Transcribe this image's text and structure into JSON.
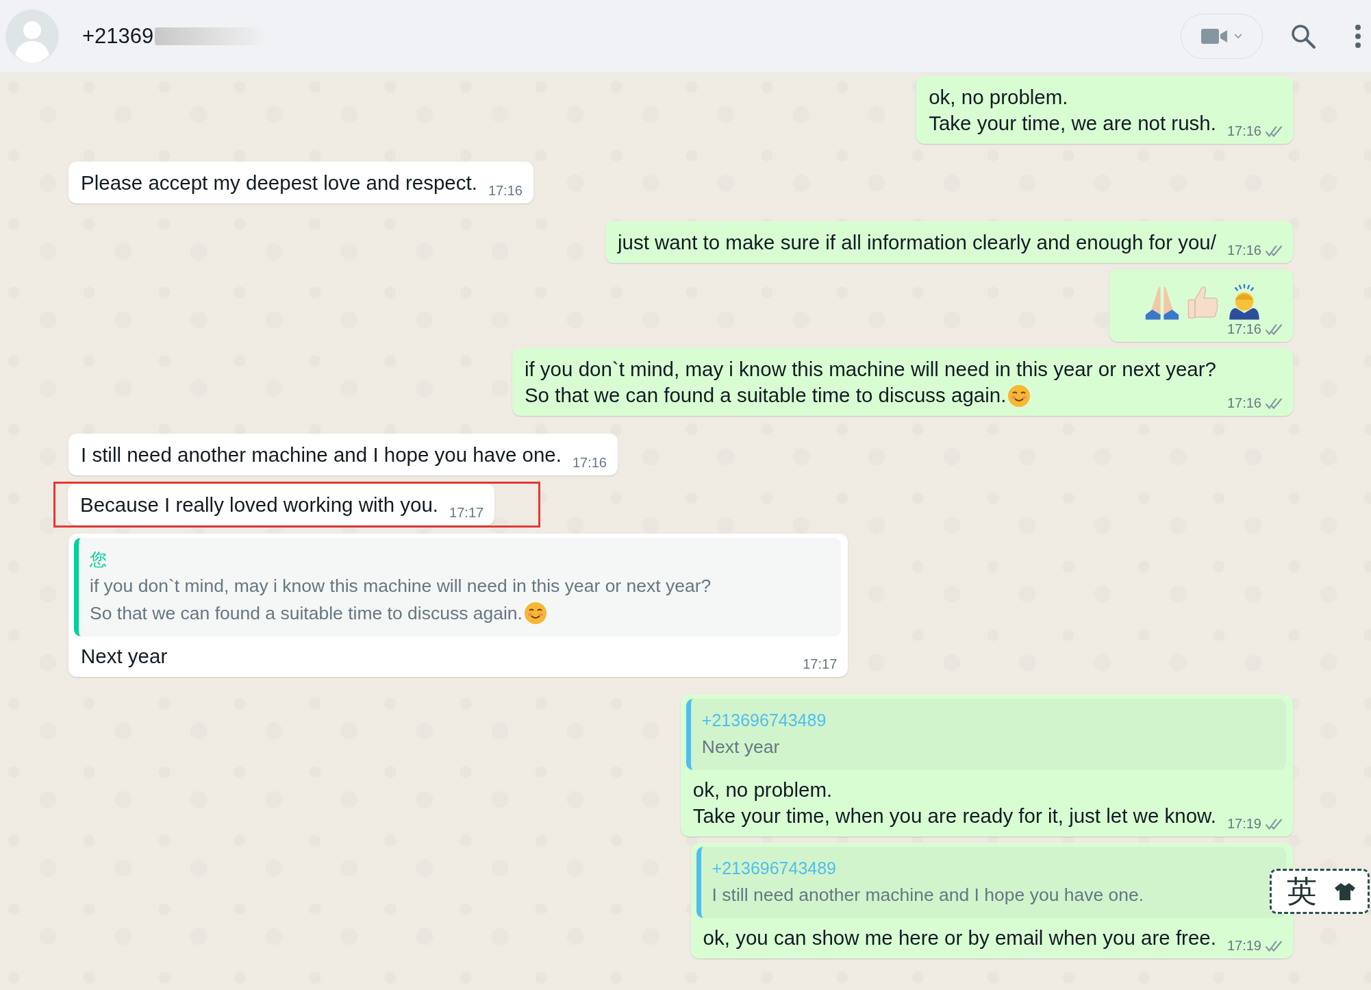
{
  "header": {
    "contact_name": "+21369"
  },
  "messages": [
    {
      "outgoing": true,
      "kind": "text",
      "text": "ok, no problem.\nTake your time, we are not rush.",
      "time": "17:16",
      "delivered": true
    },
    {
      "outgoing": false,
      "kind": "text",
      "text": "Please accept my deepest love and respect.",
      "time": "17:16"
    },
    {
      "outgoing": true,
      "kind": "text",
      "text": "just want to make sure if all information clearly and enough for you/",
      "time": "17:16",
      "delivered": true
    },
    {
      "outgoing": true,
      "kind": "emoji",
      "time": "17:16",
      "delivered": true
    },
    {
      "outgoing": true,
      "kind": "text",
      "text": "if you don`t mind, may i know this machine will need in this year or next year?\nSo that we can found a suitable time to discuss again.",
      "emoji_end": true,
      "time": "17:16",
      "delivered": true
    },
    {
      "outgoing": false,
      "kind": "text",
      "text": "I still need another machine and I hope you have one.",
      "time": "17:16"
    },
    {
      "outgoing": false,
      "kind": "text",
      "text": "Because I really loved working with you.",
      "time": "17:17",
      "highlighted": true
    },
    {
      "outgoing": false,
      "kind": "reply",
      "quote": {
        "author": "您",
        "color": "#06cf9c",
        "text": "if you don`t mind, may i know this machine will need in this year or next year?\nSo that we can found a suitable time to discuss again.",
        "emoji_end": true
      },
      "text": "Next year",
      "time": "17:17"
    },
    {
      "outgoing": true,
      "kind": "reply",
      "quote": {
        "author": "+213696743489",
        "color": "#53bdeb",
        "text": "Next year"
      },
      "text": "ok, no problem.\nTake your time, when you are ready for it, just let we know.",
      "time": "17:19",
      "delivered": true
    },
    {
      "outgoing": true,
      "kind": "reply",
      "quote": {
        "author": "+213696743489",
        "color": "#53bdeb",
        "text": "I still need another machine and I hope you have one."
      },
      "text": "ok, you can show me here or by email when you are free.",
      "time": "17:19",
      "delivered": true
    }
  ],
  "ime_indicator": {
    "label": "英"
  }
}
